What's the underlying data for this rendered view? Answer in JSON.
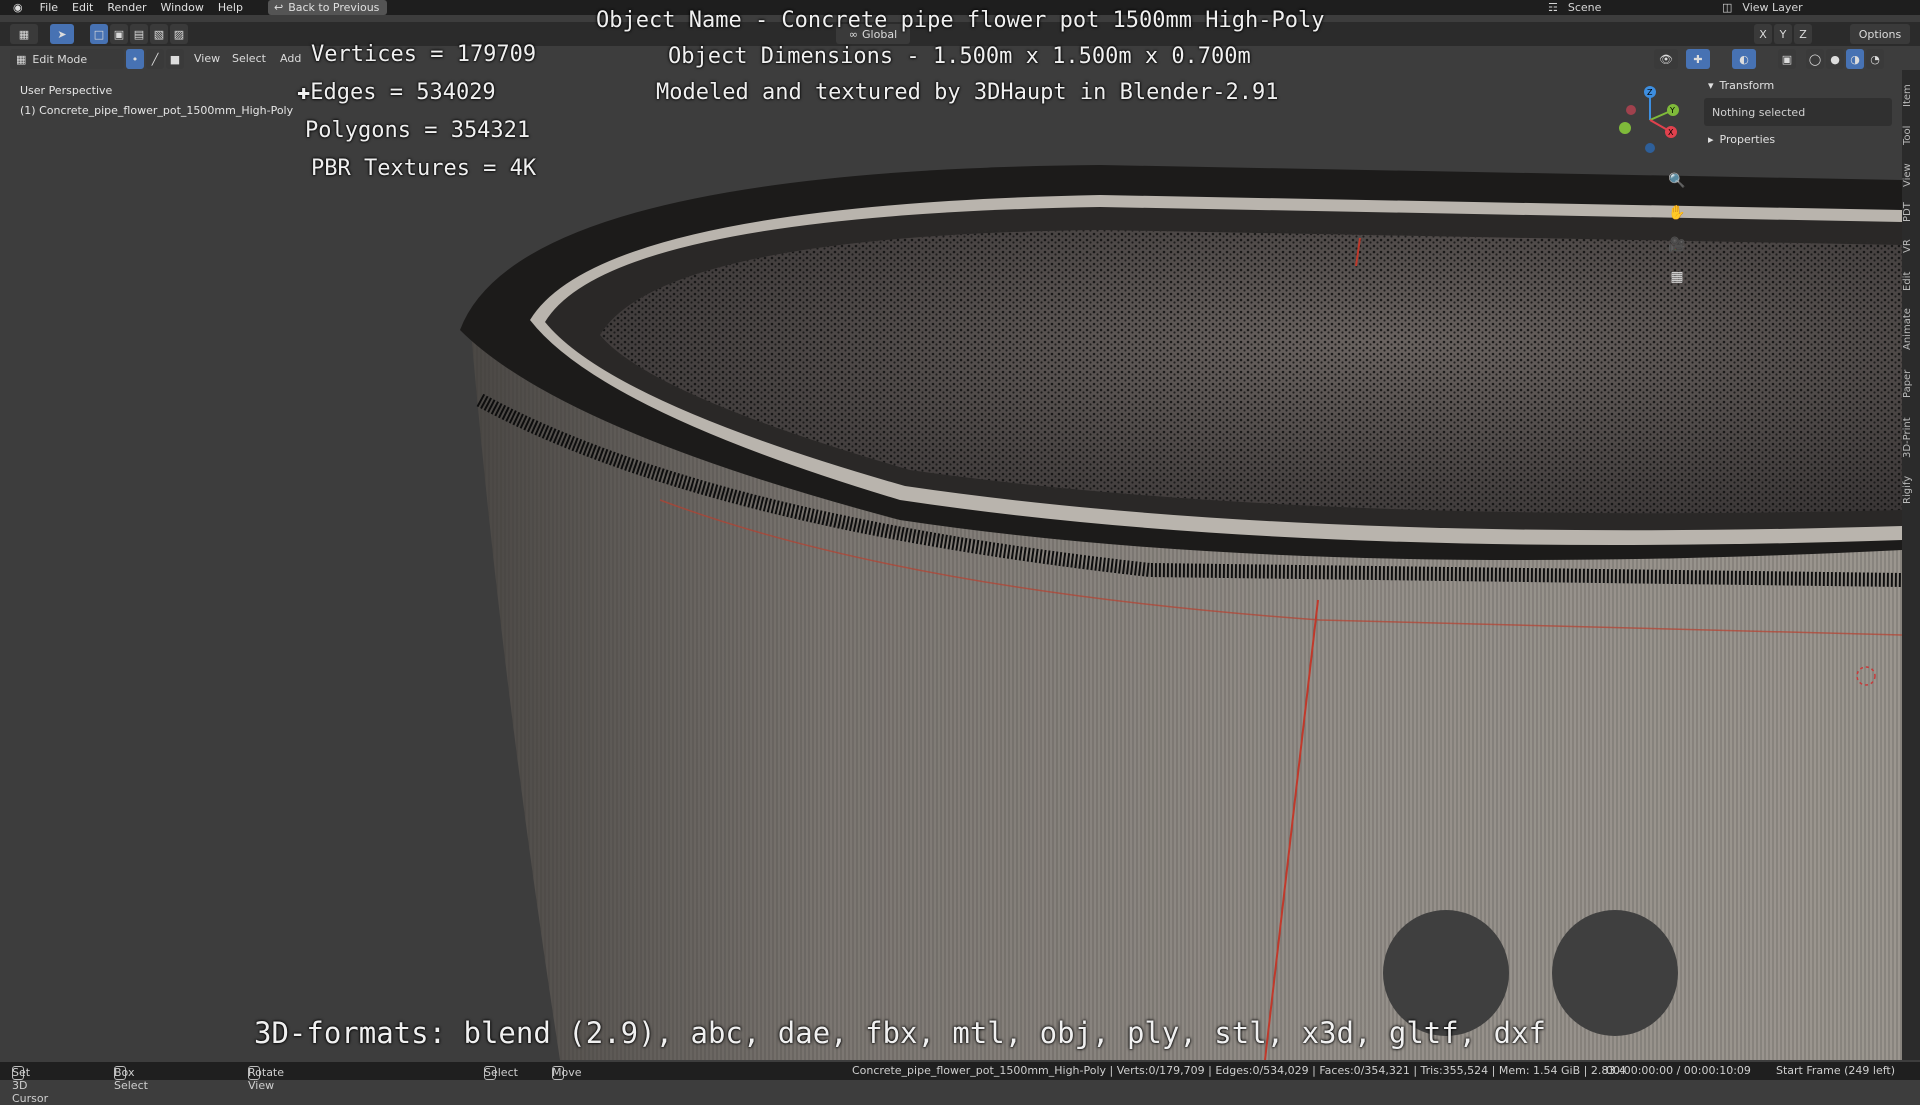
{
  "menu": {
    "items": [
      "File",
      "Edit",
      "Render",
      "Window",
      "Help"
    ],
    "back_button": "Back to Previous",
    "scene_label": "Scene",
    "view_layer_label": "View Layer"
  },
  "header": {
    "mode": "Edit Mode",
    "menus": [
      "View",
      "Select",
      "Add"
    ],
    "transform_orientation": "Global",
    "axes": [
      "X",
      "Y",
      "Z"
    ],
    "options_label": "Options"
  },
  "viewport": {
    "perspective_label": "User Perspective",
    "object_label": "(1) Concrete_pipe_flower_pot_1500mm_High-Poly"
  },
  "overlay": {
    "vertices": "Vertices = 179709",
    "edges": "Edges = 534029",
    "polygons": "Polygons = 354321",
    "textures": "PBR Textures = 4K",
    "object_name": "Object Name - Concrete pipe flower pot 1500mm High-Poly",
    "dimensions": "Object Dimensions -  1.500m x 1.500m x 0.700m",
    "credit": "Modeled and textured by 3DHaupt in Blender-2.91",
    "formats": "3D-formats: blend (2.9), abc, dae, fbx, mtl, obj, ply, stl, x3d, gltf, dxf"
  },
  "npanel": {
    "transform_header": "Transform",
    "nothing_selected": "Nothing selected",
    "properties_header": "Properties"
  },
  "side_tabs": [
    "Item",
    "Tool",
    "View",
    "PDT",
    "VR",
    "Edit",
    "Animate",
    "Paper",
    "3D-Print",
    "Rigify"
  ],
  "status": {
    "cursor": "Set 3D Cursor",
    "box_select": "Box Select",
    "rotate": "Rotate View",
    "select": "Select",
    "move": "Move",
    "stats": "Concrete_pipe_flower_pot_1500mm_High-Poly | Verts:0/179,709 | Edges:0/534,029 | Faces:0/354,321 | Tris:355,524 | Mem: 1.54 GiB | 2.83.4",
    "time": "00:00:00:00 / 00:00:10:09",
    "frame": "Start Frame (249 left)"
  },
  "colors": {
    "bg": "#3d3d3d",
    "concrete": "#8c8781",
    "seam_red": "#c0392b",
    "gizmo_x": "#e0414d",
    "gizmo_y": "#7fba3a",
    "gizmo_z": "#3d8ee0"
  }
}
